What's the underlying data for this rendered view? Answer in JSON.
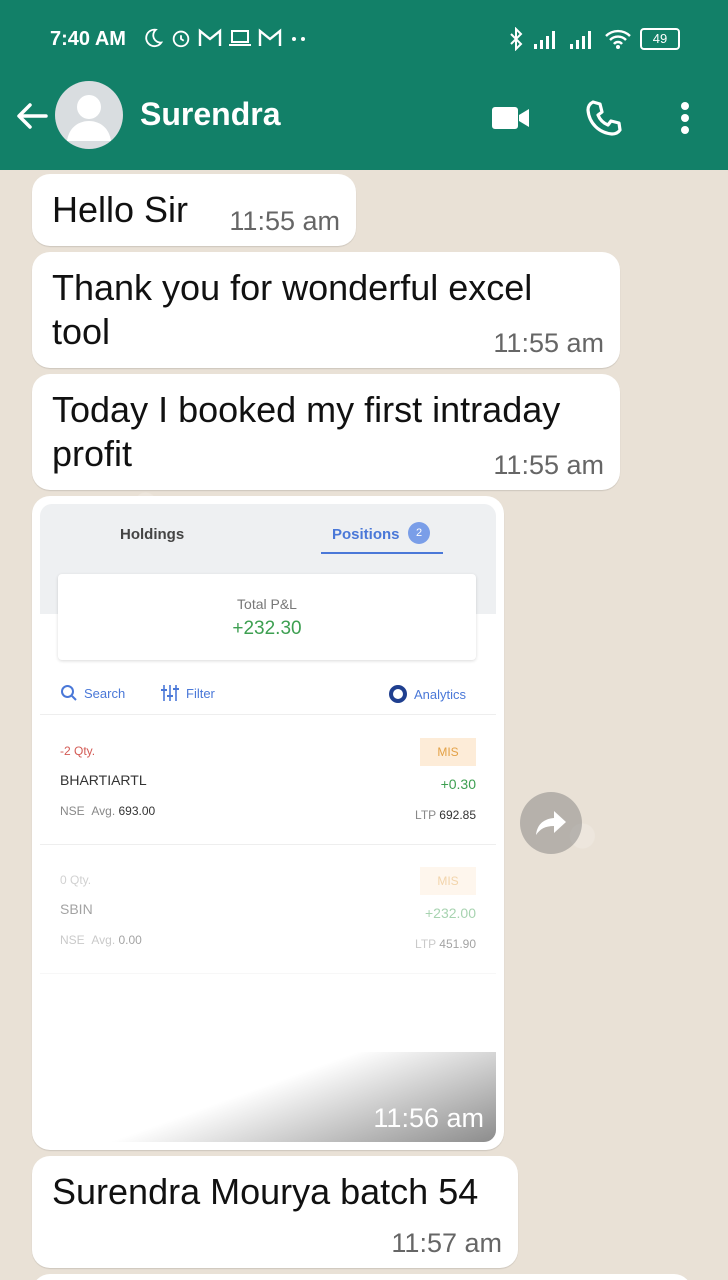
{
  "status_bar": {
    "time": "7:40 AM",
    "battery": "49",
    "icons_left": [
      "moon-icon",
      "alarm-icon",
      "gmail-icon",
      "laptop-icon",
      "gmail-icon",
      "more-dots-icon"
    ],
    "icons_right": [
      "bluetooth-icon",
      "signal-icon",
      "signal-icon",
      "wifi-icon",
      "battery-icon"
    ]
  },
  "header": {
    "contact_name": "Surendra",
    "colors": {
      "bar": "#128068"
    }
  },
  "messages": [
    {
      "text": "Hello Sir",
      "time": "11:55 am"
    },
    {
      "text": "Thank you for wonderful excel tool",
      "time": "11:55 am"
    },
    {
      "text": "Today I booked my first intraday profit",
      "time": "11:55 am"
    },
    {
      "text": "Surendra Mourya batch 54",
      "time": "11:57 am"
    }
  ],
  "image_message": {
    "time": "11:56 am",
    "tabs": {
      "holdings": "Holdings",
      "positions": "Positions",
      "positions_count": "2"
    },
    "total_pl_label": "Total P&L",
    "total_pl_value": "+232.30",
    "toolbar": {
      "search": "Search",
      "filter": "Filter",
      "analytics": "Analytics"
    },
    "positions": [
      {
        "qty": "-2 Qty.",
        "symbol": "BHARTIARTL",
        "exchange": "NSE",
        "avg_label": "Avg.",
        "avg": "693.00",
        "product": "MIS",
        "pnl": "+0.30",
        "ltp_label": "LTP",
        "ltp": "692.85"
      },
      {
        "qty": "0 Qty.",
        "symbol": "SBIN",
        "exchange": "NSE",
        "avg_label": "Avg.",
        "avg": "0.00",
        "product": "MIS",
        "pnl": "+232.00",
        "ltp_label": "LTP",
        "ltp": "451.90"
      }
    ]
  },
  "colors": {
    "chat_background": "#e9e1d6",
    "bubble": "#ffffff",
    "profit": "#3d9f51",
    "accent_blue": "#4a78d8"
  }
}
